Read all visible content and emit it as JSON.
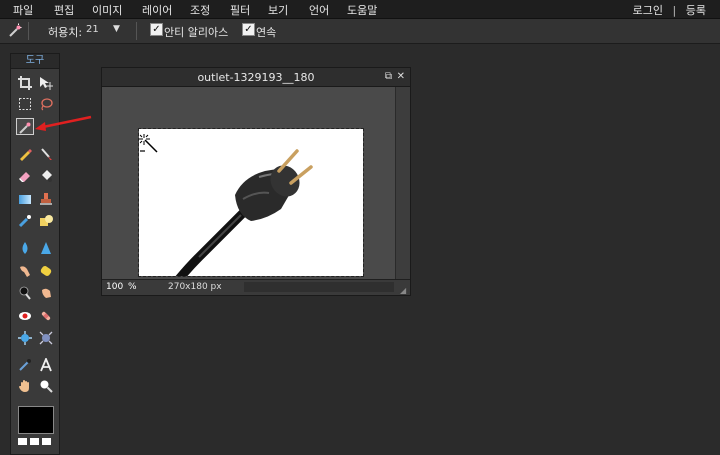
{
  "menu": {
    "items": [
      "파일",
      "편집",
      "이미지",
      "레이어",
      "조정",
      "필터",
      "보기",
      "언어",
      "도움말"
    ],
    "login": "로그인",
    "separator": "|",
    "register": "등록"
  },
  "options": {
    "tolerance_label": "허용치:",
    "tolerance_value": "21",
    "antialias_label": "안티 알리아스",
    "contiguous_label": "연속",
    "check_mark": "✓",
    "dropdown_arrow": "▼"
  },
  "toolpanel": {
    "title": "도구",
    "active_tool": "magic-wand",
    "tools": [
      "crop-icon",
      "move-icon",
      "marquee-select-icon",
      "lasso-icon",
      "magic-wand-icon",
      "pencil-icon",
      "brush-icon",
      "eraser-icon",
      "paint-bucket-icon",
      "gradient-icon",
      "clone-stamp-icon",
      "color-replace-icon",
      "shape-icon",
      "blur-icon",
      "sharpen-icon",
      "smudge-icon",
      "sponge-icon",
      "dodge-icon",
      "burn-icon",
      "red-eye-icon",
      "spot-heal-icon",
      "bloat-icon",
      "pinch-icon",
      "color-picker-icon",
      "type-icon",
      "hand-icon",
      "zoom-icon"
    ],
    "primary_color": "#000000"
  },
  "image_window": {
    "title": "outlet-1329193__180",
    "restore_button": "⧉",
    "close_button": "✕",
    "zoom_value": "100",
    "zoom_unit": "%",
    "image_size": "270x180 px",
    "resize_grip": "◢"
  },
  "colors": {
    "accent_blue": "#7fb0e0",
    "annotation_red": "#e02020"
  }
}
